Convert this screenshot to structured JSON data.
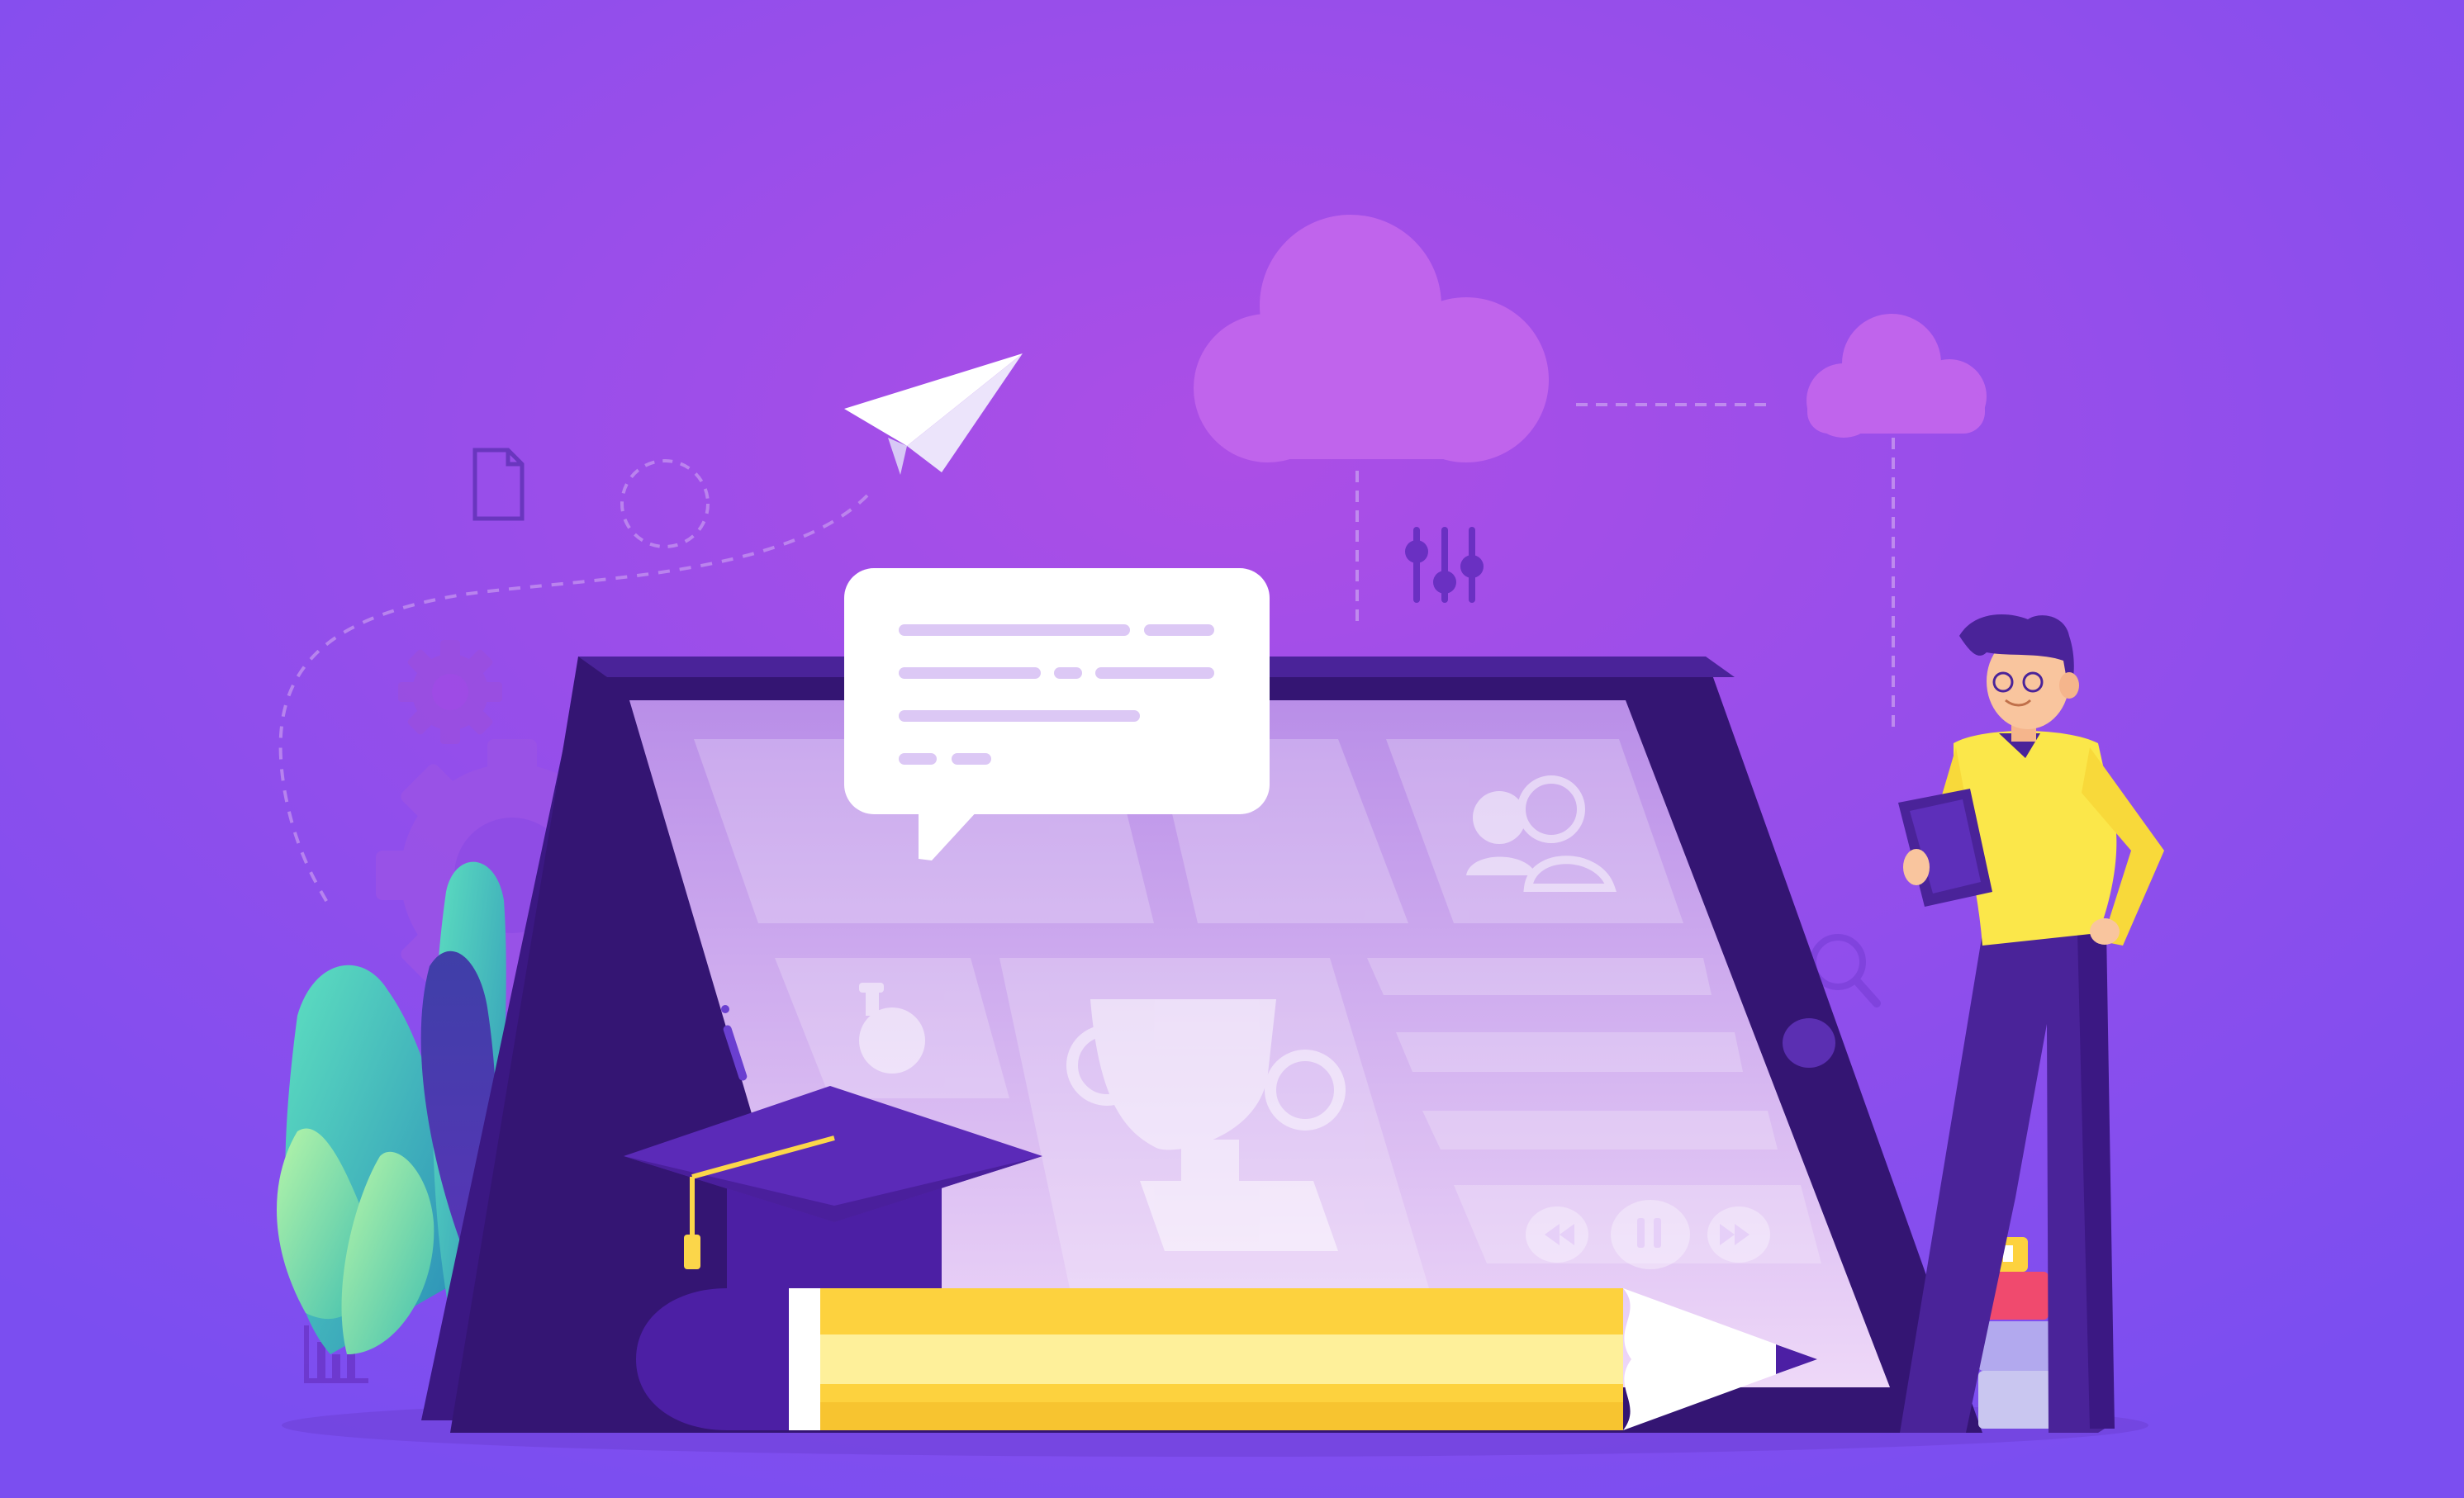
{
  "illustration": {
    "subject": "online-education",
    "colors": {
      "background_light": "#a64fe6",
      "background_dark": "#7a4ff0",
      "tablet_frame": "#341573",
      "tablet_screen": "#d9b9f2",
      "cloud": "#c068ec",
      "shirt": "#fbe74a",
      "pants": "#4a2399",
      "pencil_body": "#fdd23e",
      "leaf_teal": "#39b9b0",
      "leaf_green": "#8fe8b0"
    },
    "icons": [
      "paper-plane-icon",
      "document-icon",
      "gear-icon",
      "cloud-icon",
      "sliders-icon",
      "search-icon",
      "bar-chart-icon",
      "chat-bubble-icon",
      "users-icon",
      "flask-icon",
      "trophy-icon",
      "rewind-icon",
      "pause-icon",
      "fast-forward-icon",
      "graduation-cap-icon",
      "pencil-icon",
      "books-icon"
    ]
  }
}
